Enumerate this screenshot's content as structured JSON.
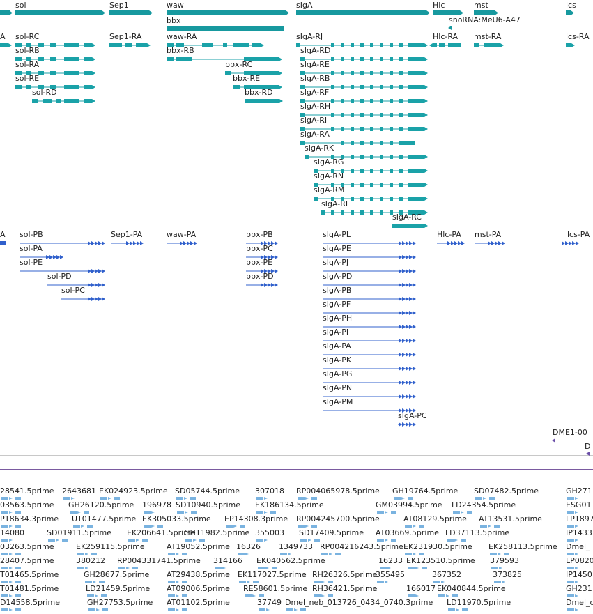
{
  "colors": {
    "gene": "#17999f",
    "transcript": "#1aa2a8",
    "polypeptide": "#3060cc",
    "repeat": "#6b4fa8",
    "est": "#7ab3e0",
    "separator": "#c8c8c8",
    "track_separator": "#7a5aa0"
  },
  "tracks": {
    "genes": {
      "features": [
        {
          "id": "sol",
          "label": "sol"
        },
        {
          "id": "sep1",
          "label": "Sep1"
        },
        {
          "id": "waw",
          "label": "waw"
        },
        {
          "id": "bbx",
          "label": "bbx"
        },
        {
          "id": "sIgA",
          "label": "sIgA"
        },
        {
          "id": "Hlc",
          "label": "Hlc"
        },
        {
          "id": "mst",
          "label": "mst"
        },
        {
          "id": "snoRNA",
          "label": "snoRNA:MeU6-A47"
        },
        {
          "id": "lcs",
          "label": "lcs"
        }
      ]
    },
    "transcripts": {
      "features": [
        {
          "id": "A",
          "label": "A"
        },
        {
          "id": "sol-RC",
          "label": "sol-RC"
        },
        {
          "id": "sol-RB",
          "label": "sol-RB"
        },
        {
          "id": "sol-RA",
          "label": "sol-RA"
        },
        {
          "id": "sol-RE",
          "label": "sol-RE"
        },
        {
          "id": "sol-RD",
          "label": "sol-RD"
        },
        {
          "id": "Sep1-RA",
          "label": "Sep1-RA"
        },
        {
          "id": "waw-RA",
          "label": "waw-RA"
        },
        {
          "id": "bbx-RB",
          "label": "bbx-RB"
        },
        {
          "id": "bbx-RC",
          "label": "bbx-RC"
        },
        {
          "id": "bbx-RE",
          "label": "bbx-RE"
        },
        {
          "id": "bbx-RD",
          "label": "bbx-RD"
        },
        {
          "id": "sIgA-RJ",
          "label": "sIgA-RJ"
        },
        {
          "id": "sIgA-RD",
          "label": "sIgA-RD"
        },
        {
          "id": "sIgA-RE",
          "label": "sIgA-RE"
        },
        {
          "id": "sIgA-RB",
          "label": "sIgA-RB"
        },
        {
          "id": "sIgA-RF",
          "label": "sIgA-RF"
        },
        {
          "id": "sIgA-RH",
          "label": "sIgA-RH"
        },
        {
          "id": "sIgA-RI",
          "label": "sIgA-RI"
        },
        {
          "id": "sIgA-RA",
          "label": "sIgA-RA"
        },
        {
          "id": "sIgA-RK",
          "label": "sIgA-RK"
        },
        {
          "id": "sIgA-RG",
          "label": "sIgA-RG"
        },
        {
          "id": "sIgA-RN",
          "label": "sIgA-RN"
        },
        {
          "id": "sIgA-RM",
          "label": "sIgA-RM"
        },
        {
          "id": "sIgA-RL",
          "label": "sIgA-RL"
        },
        {
          "id": "sIgA-RC",
          "label": "sIgA-RC"
        },
        {
          "id": "Hlc-RA",
          "label": "Hlc-RA"
        },
        {
          "id": "mst-RA",
          "label": "mst-RA"
        },
        {
          "id": "lcs-RA",
          "label": "lcs-RA"
        }
      ]
    },
    "polypeptides": {
      "features": [
        {
          "id": "A",
          "label": "A"
        },
        {
          "id": "sol-PB",
          "label": "sol-PB"
        },
        {
          "id": "sol-PA",
          "label": "sol-PA"
        },
        {
          "id": "sol-PE",
          "label": "sol-PE"
        },
        {
          "id": "sol-PD",
          "label": "sol-PD"
        },
        {
          "id": "sol-PC",
          "label": "sol-PC"
        },
        {
          "id": "Sep1-PA",
          "label": "Sep1-PA"
        },
        {
          "id": "waw-PA",
          "label": "waw-PA"
        },
        {
          "id": "bbx-PB",
          "label": "bbx-PB"
        },
        {
          "id": "bbx-PC",
          "label": "bbx-PC"
        },
        {
          "id": "bbx-PE",
          "label": "bbx-PE"
        },
        {
          "id": "bbx-PD",
          "label": "bbx-PD"
        },
        {
          "id": "sIgA-PL",
          "label": "sIgA-PL"
        },
        {
          "id": "sIgA-PE",
          "label": "sIgA-PE"
        },
        {
          "id": "sIgA-PJ",
          "label": "sIgA-PJ"
        },
        {
          "id": "sIgA-PD",
          "label": "sIgA-PD"
        },
        {
          "id": "sIgA-PB",
          "label": "sIgA-PB"
        },
        {
          "id": "sIgA-PF",
          "label": "sIgA-PF"
        },
        {
          "id": "sIgA-PH",
          "label": "sIgA-PH"
        },
        {
          "id": "sIgA-PI",
          "label": "sIgA-PI"
        },
        {
          "id": "sIgA-PA",
          "label": "sIgA-PA"
        },
        {
          "id": "sIgA-PK",
          "label": "sIgA-PK"
        },
        {
          "id": "sIgA-PG",
          "label": "sIgA-PG"
        },
        {
          "id": "sIgA-PN",
          "label": "sIgA-PN"
        },
        {
          "id": "sIgA-PM",
          "label": "sIgA-PM"
        },
        {
          "id": "sIgA-PC",
          "label": "sIgA-PC"
        },
        {
          "id": "Hlc-PA",
          "label": "Hlc-PA"
        },
        {
          "id": "mst-PA",
          "label": "mst-PA"
        },
        {
          "id": "lcs-PA",
          "label": "lcs-PA"
        }
      ]
    },
    "repeats": {
      "features": [
        {
          "id": "dme1-00",
          "label": "DME1-00"
        },
        {
          "id": "d",
          "label": "D"
        }
      ]
    },
    "ests": {
      "rows": [
        [
          "28541.5prime",
          "2643681",
          "EK024923.5prime",
          "SD05744.5prime",
          "307018",
          "RP004065978.5prime",
          "GH19764.5prime",
          "SD07482.5prime",
          "GH271"
        ],
        [
          "03563.5prime",
          "GH26120.5prime",
          "196978",
          "SD10940.5prime",
          "EK186134.5prime",
          "GM03994.5prime",
          "LD24354.5prime",
          "ESG01"
        ],
        [
          "P18634.3prime",
          "UT01477.5prime",
          "EK305033.5prime",
          "EP14308.3prime",
          "RP004245700.5prime",
          "AT08129.5prime",
          "AT13531.5prime",
          "LP1897"
        ],
        [
          "14080",
          "SD01911.5prime",
          "EK206641.5prime",
          "GH11982.5prime",
          "355003",
          "SD17409.5prime",
          "AT03669.5prime",
          "LD37113.5prime",
          "IP1433"
        ],
        [
          "03263.5prime",
          "EK259115.5prime",
          "AT19052.5prime",
          "16326",
          "1349733",
          "RP004216243.5prime",
          "EK231930.5prime",
          "EK258113.5prime",
          "Dmel_"
        ],
        [
          "28407.5prime",
          "380212",
          "RP004331741.5prime",
          "314166",
          "EK040562.5prime",
          "16233",
          "EK123510.5prime",
          "379593",
          "LP0820"
        ],
        [
          "T01465.5prime",
          "GH28677.5prime",
          "AT29438.5prime",
          "EK117027.5prime",
          "RH26326.5prime",
          "355495",
          "367352",
          "373825",
          "IP1450"
        ],
        [
          "T01481.5prime",
          "LD21459.5prime",
          "AT09006.5prime",
          "RE58601.5prime",
          "RH36421.5prime",
          "166017",
          "EK040844.5prime",
          "GH231"
        ],
        [
          "D14558.5prime",
          "GH27753.5prime",
          "AT01102.5prime",
          "37749",
          "Dmel_neb_013726_0434_0740.3prime",
          "LD11970.5prime",
          "Dmel_c"
        ]
      ]
    }
  }
}
